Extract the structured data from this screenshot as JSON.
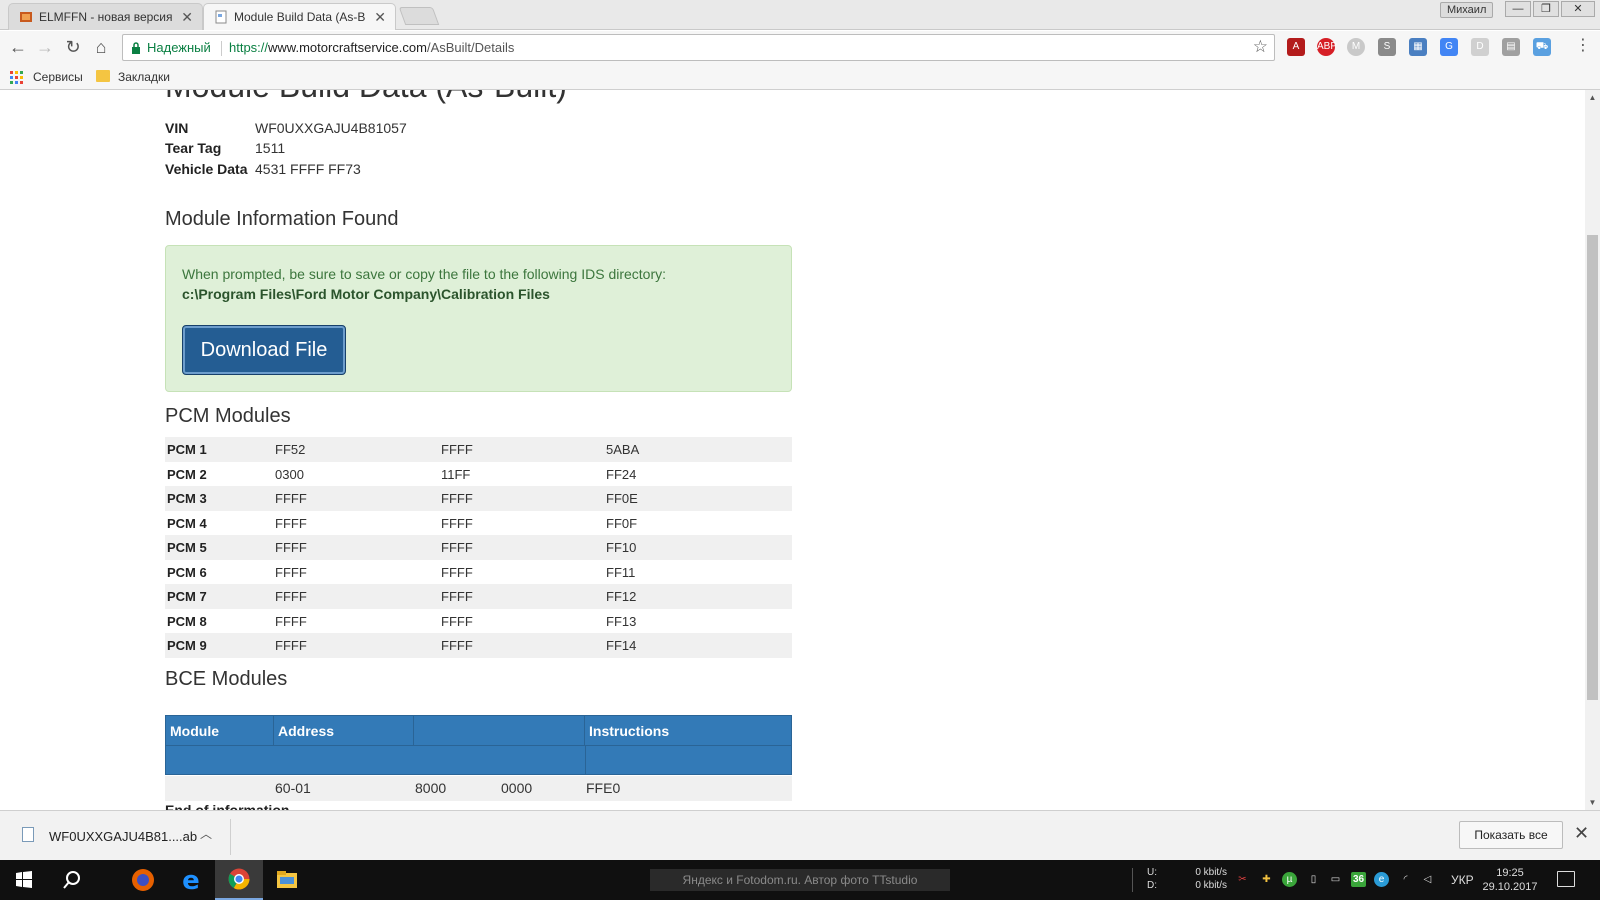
{
  "browser": {
    "tabs": [
      {
        "title": "ELMFFN - новая версия",
        "active": false
      },
      {
        "title": "Module Build Data (As-B",
        "active": true
      }
    ],
    "profile_name": "Михаил",
    "secure_label": "Надежный",
    "url_scheme": "https://",
    "url_host": "www.motorcraftservice.com",
    "url_path": "/AsBuilt/Details",
    "bookmarks": [
      "Сервисы",
      "Закладки"
    ]
  },
  "page": {
    "heading": "Module Build Data (As-Built)",
    "vehicle_info": [
      {
        "label": "VIN",
        "value": "WF0UXXGAJU4B81057"
      },
      {
        "label": "Tear Tag",
        "value": "1511"
      },
      {
        "label": "Vehicle Data",
        "value": "4531 FFFF FF73"
      }
    ],
    "module_info_title": "Module Information Found",
    "alert_text": "When prompted, be sure to save or copy the file to the following IDS directory:",
    "alert_path": "c:\\Program Files\\Ford Motor Company\\Calibration Files",
    "download_label": "Download File",
    "pcm_title": "PCM Modules",
    "pcm_rows": [
      [
        "PCM 1",
        "FF52",
        "FFFF",
        "5ABA"
      ],
      [
        "PCM 2",
        "0300",
        "11FF",
        "FF24"
      ],
      [
        "PCM 3",
        "FFFF",
        "FFFF",
        "FF0E"
      ],
      [
        "PCM 4",
        "FFFF",
        "FFFF",
        "FF0F"
      ],
      [
        "PCM 5",
        "FFFF",
        "FFFF",
        "FF10"
      ],
      [
        "PCM 6",
        "FFFF",
        "FFFF",
        "FF11"
      ],
      [
        "PCM 7",
        "FFFF",
        "FFFF",
        "FF12"
      ],
      [
        "PCM 8",
        "FFFF",
        "FFFF",
        "FF13"
      ],
      [
        "PCM 9",
        "FFFF",
        "FFFF",
        "FF14"
      ]
    ],
    "bce_title": "BCE Modules",
    "bce_headers": [
      "Module",
      "Address",
      "",
      "Instructions"
    ],
    "bce_row": [
      "",
      "60-01",
      "8000",
      "0000",
      "FFE0"
    ],
    "end_text": "End of information"
  },
  "download_shelf": {
    "filename": "WF0UXXGAJU4B81....ab",
    "show_all_label": "Показать все"
  },
  "taskbar": {
    "watermark": "Яндекс и Fotodom.ru. Автор фото TTstudio",
    "net_labels": [
      "U:",
      "D:"
    ],
    "net_rates": [
      "0 kbit/s",
      "0 kbit/s"
    ],
    "tray_badge": "36",
    "language": "УКР",
    "time": "19:25",
    "date": "29.10.2017"
  },
  "colors": {
    "accent": "#337ab7",
    "button": "#245d93",
    "alert_bg": "#dff0d8",
    "secure": "#0b8043"
  }
}
